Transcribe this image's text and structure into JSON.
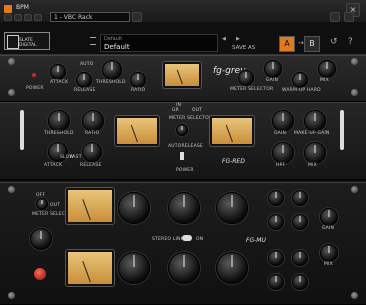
{
  "window": {
    "title": "BPM",
    "track_name": "1 - VBC Rack"
  },
  "header": {
    "logo": "SLATE DIGITAL",
    "preset_label": "Default",
    "preset_name": "Default",
    "save_as": "SAVE AS",
    "ab_a": "A",
    "ab_b": "B"
  },
  "unit_fg_grey": {
    "brand": "fg-grey",
    "labels": {
      "attack": "ATTACK",
      "auto": "AUTO",
      "release": "RELEASE",
      "threshold": "THRESHOLD",
      "ratio": "RATIO",
      "power": "POWER",
      "meter_selector": "METER SELECTOR",
      "gain": "GAIN",
      "warm_up_hard": "WARM-UP HARD",
      "mix": "MIX"
    }
  },
  "unit_fg_red": {
    "brand": "FG-RED",
    "labels": {
      "threshold": "THRESHOLD",
      "ratio": "RATIO",
      "attack": "ATTACK",
      "release": "RELEASE",
      "slow": "SLOW",
      "fast": "FAST",
      "meter_selector": "METER SELECTOR",
      "autorelease": "AUTORELEASE",
      "power": "POWER",
      "gain": "GAIN",
      "mix": "MIX",
      "hpf": "HPF",
      "make_up_gain": "MAKE-UP GAIN",
      "in": "IN",
      "out": "OUT",
      "gr": "GR"
    }
  },
  "unit_fg_mu": {
    "brand": "FG-MU",
    "labels": {
      "meter_selector": "METER SELECTOR",
      "off": "OFF",
      "out": "OUT",
      "stereo_link": "STEREO LINK",
      "on": "ON",
      "gain": "GAIN",
      "mix": "MIX"
    }
  },
  "colors": {
    "accent": "#e07a1f",
    "meter_face": "#e2b56a",
    "panel": "#222222",
    "brand_red": "#c02a1a"
  }
}
